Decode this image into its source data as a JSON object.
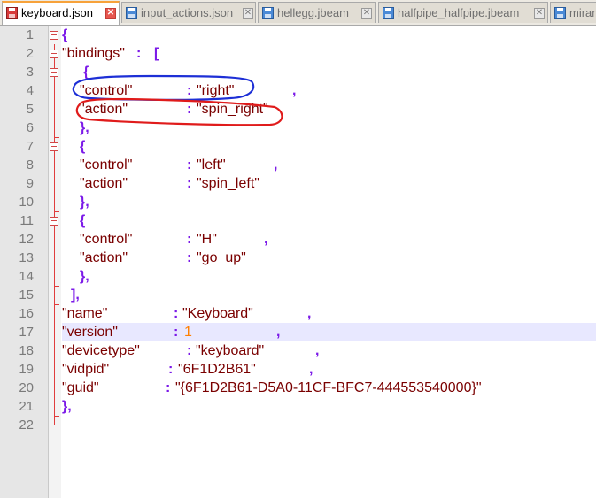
{
  "tabs": [
    {
      "label": "keyboard.json",
      "active": true
    },
    {
      "label": "input_actions.json",
      "active": false
    },
    {
      "label": "hellegg.jbeam",
      "active": false
    },
    {
      "label": "halfpipe_halfpipe.jbeam",
      "active": false
    },
    {
      "label": "mirar",
      "active": false
    }
  ],
  "line_numbers": [
    "1",
    "2",
    "3",
    "4",
    "5",
    "6",
    "7",
    "8",
    "9",
    "10",
    "11",
    "12",
    "13",
    "14",
    "15",
    "16",
    "17",
    "18",
    "19",
    "20",
    "21",
    "22"
  ],
  "code": {
    "l1": {
      "brace": "{"
    },
    "l2": {
      "key": "\"bindings\"",
      "colon": ":",
      "bracket": "["
    },
    "l3": {
      "brace": "{"
    },
    "l4": {
      "key": "\"control\"",
      "colon": ":",
      "value": "\"right\"",
      "comma": ","
    },
    "l5": {
      "key": "\"action\"",
      "colon": ":",
      "value": "\"spin_right\""
    },
    "l6": {
      "brace": "},"
    },
    "l7": {
      "brace": "{"
    },
    "l8": {
      "key": "\"control\"",
      "colon": ":",
      "value": "\"left\"",
      "comma": ","
    },
    "l9": {
      "key": "\"action\"",
      "colon": ":",
      "value": "\"spin_left\""
    },
    "l10": {
      "brace": "},"
    },
    "l11": {
      "brace": "{"
    },
    "l12": {
      "key": "\"control\"",
      "colon": ":",
      "value": "\"H\"",
      "comma": ","
    },
    "l13": {
      "key": "\"action\"",
      "colon": ":",
      "value": "\"go_up\""
    },
    "l14": {
      "brace": "},"
    },
    "l15": {
      "bracket": "],"
    },
    "l16": {
      "key": "\"name\"",
      "colon": ":",
      "value": "\"Keyboard\"",
      "comma": ","
    },
    "l17": {
      "key": "\"version\"",
      "colon": ":",
      "value": "1",
      "comma": ","
    },
    "l18": {
      "key": "\"devicetype\"",
      "colon": ":",
      "value": "\"keyboard\"",
      "comma": ","
    },
    "l19": {
      "key": "\"vidpid\"",
      "colon": ":",
      "value": "\"6F1D2B61\"",
      "comma": ","
    },
    "l20": {
      "key": "\"guid\"",
      "colon": ":",
      "value": "\"{6F1D2B61-D5A0-11CF-BFC7-444553540000}\""
    },
    "l21": {
      "brace": "},"
    }
  },
  "colors": {
    "brace": "#7b19e8",
    "string": "#7a0000",
    "number": "#ff7f00",
    "current_line": "#e8e8ff",
    "fold_marker": "#e03d3d",
    "annotation_blue": "#1d2fd6",
    "annotation_red": "#e01b1b"
  },
  "icons": {
    "active_tab": "red-floppy-disk-icon",
    "inactive_tab": "blue-floppy-disk-icon",
    "close": "close-icon"
  }
}
